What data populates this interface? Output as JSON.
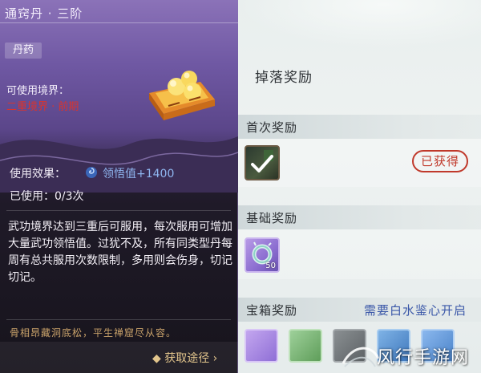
{
  "item": {
    "title": "通窍丹 · 三阶",
    "tag": "丹药",
    "realm_label": "可使用境界：",
    "realm_value": "二重境界 · 前期",
    "effect_label": "使用效果：",
    "effect_value": "领悟值+1400",
    "used_text": "已使用：0/3次",
    "description": "武功境界达到三重后可服用，每次服用可增加大量武功领悟值。过犹不及，所有同类型丹每周有总共服用次数限制，多用则会伤身，切记切记。",
    "poem": "骨相昂藏洞底松，平生禅窟尽从容。",
    "obtain_label": "◆ 获取途径 ›"
  },
  "rewards": {
    "title": "掉落奖励",
    "first": {
      "label": "首次奖励",
      "status": "已获得",
      "icon": "checkmark-icon"
    },
    "basic": {
      "label": "基础奖励",
      "quantity": "50",
      "icon": "jade-ring-icon"
    },
    "chest": {
      "label": "宝箱奖励",
      "note": "需要白水鉴心开启"
    }
  },
  "watermark": "风行手游网",
  "colors": {
    "accent_purple": "#6f58a3",
    "realm_red": "#d9342e",
    "effect_blue": "#8fb6f0",
    "stamp_red": "#c0392b",
    "note_blue": "#3a57a8"
  }
}
